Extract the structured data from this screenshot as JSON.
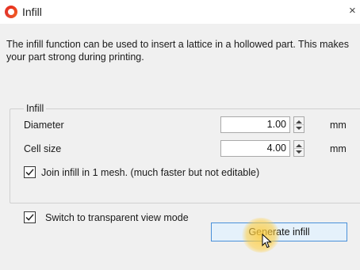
{
  "window": {
    "title": "Infill",
    "close_glyph": "×"
  },
  "description": "The infill function can be used to insert a lattice in a hollowed part. This makes your part strong during printing.",
  "group": {
    "legend": "Infill",
    "diameter": {
      "label": "Diameter",
      "value": "1.00",
      "unit": "mm"
    },
    "cell_size": {
      "label": "Cell size",
      "value": "4.00",
      "unit": "mm"
    },
    "join_mesh": {
      "label": "Join infill in 1 mesh. (much faster but not editable)",
      "checked": true
    }
  },
  "transparent_view": {
    "label": "Switch to transparent view mode",
    "checked": true
  },
  "generate_button": {
    "label": "Generate infill"
  },
  "colors": {
    "accent": "#4a90d9",
    "icon_red": "#e8321f",
    "click_highlight": "#ffcd3c"
  }
}
